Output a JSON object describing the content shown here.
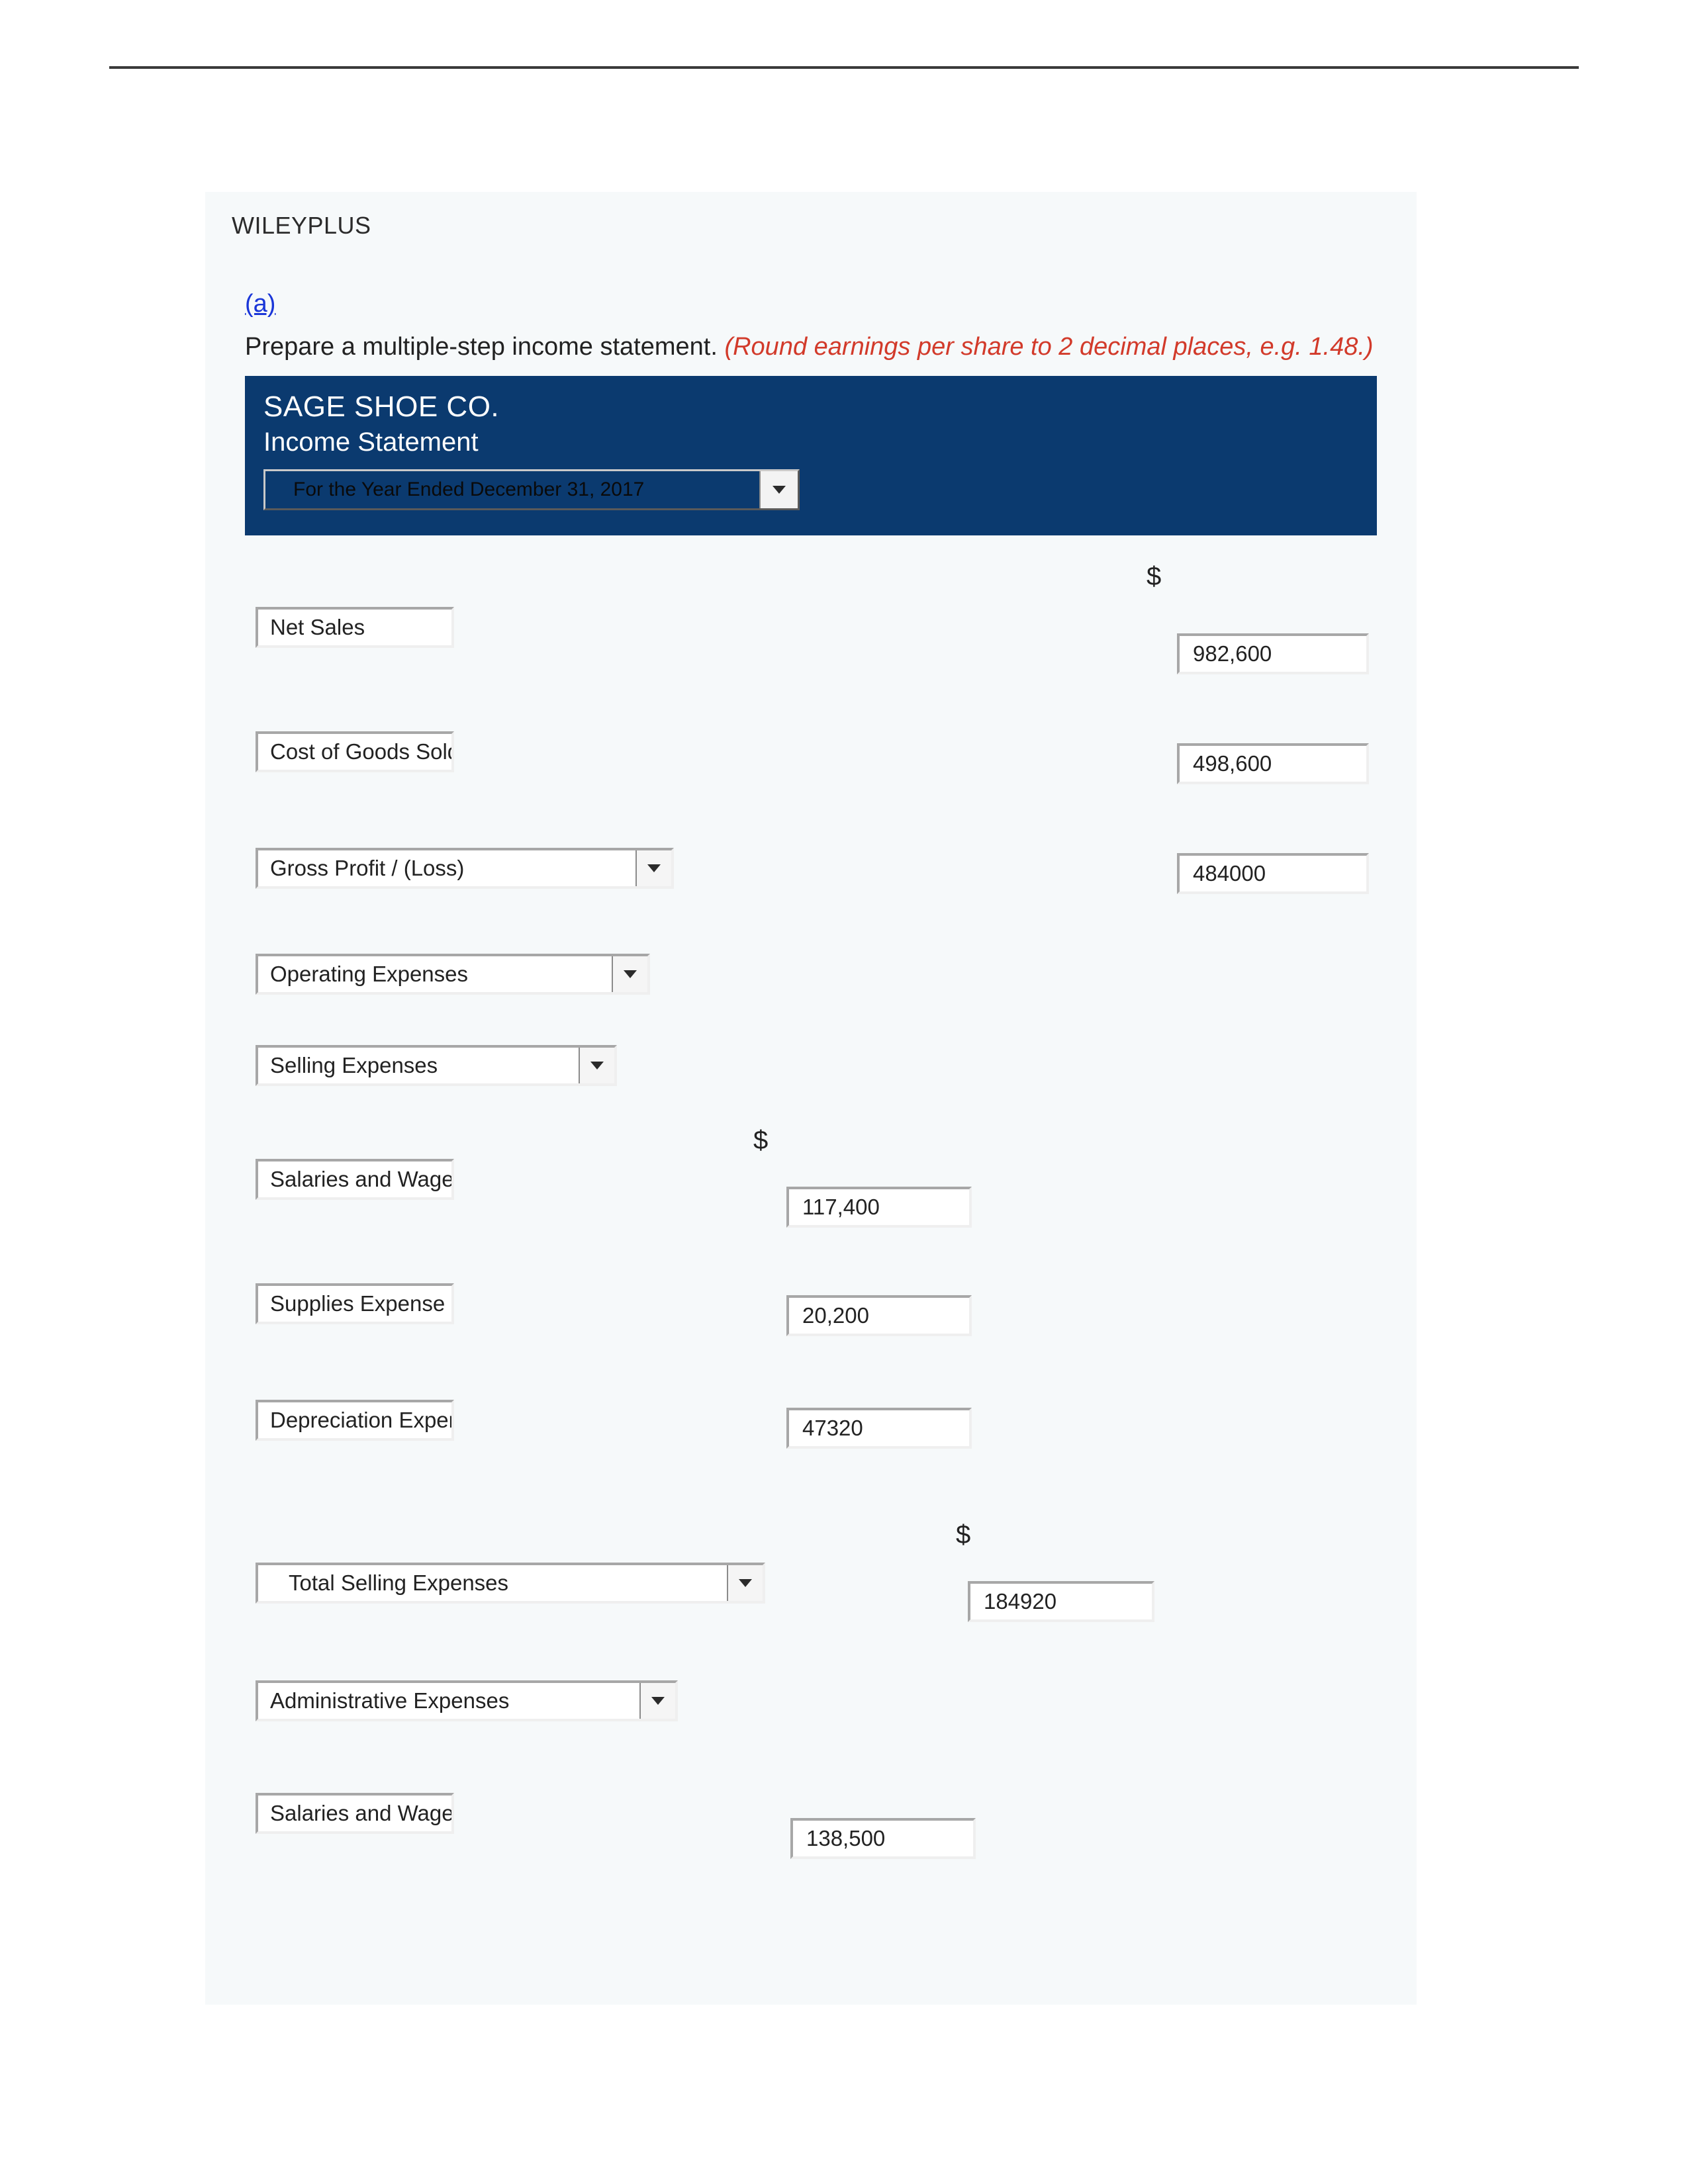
{
  "header_label": "WILEYPLUS",
  "part_link": "(a)",
  "instruction_plain": "Prepare a multiple-step income statement. ",
  "instruction_red": "(Round earnings per share to 2 decimal places, e.g. 1.48.)",
  "statement": {
    "company": "SAGE SHOE CO.",
    "title": "Income Statement",
    "period": "For the Year Ended December 31, 2017"
  },
  "currency_symbol": "$",
  "lines": {
    "net_sales": {
      "label": "Net Sales",
      "value": "982,600"
    },
    "cogs": {
      "label": "Cost of Goods Sold",
      "value": "498,600"
    },
    "gross_profit": {
      "label": "Gross Profit / (Loss)",
      "value": "484000"
    },
    "op_exp": {
      "label": "Operating Expenses"
    },
    "sell_exp": {
      "label": "Selling Expenses"
    },
    "sal_wages_sell": {
      "label": "Salaries and Wages Expense",
      "value": "117,400"
    },
    "supplies": {
      "label": "Supplies Expense",
      "value": "20,200"
    },
    "depr": {
      "label": "Depreciation Expense",
      "value": "47320"
    },
    "total_sell": {
      "label": "Total Selling Expenses",
      "value": "184920"
    },
    "admin_exp": {
      "label": "Administrative Expenses"
    },
    "sal_wages_admin": {
      "label": "Salaries and Wages Expense",
      "value": "138,500"
    }
  }
}
